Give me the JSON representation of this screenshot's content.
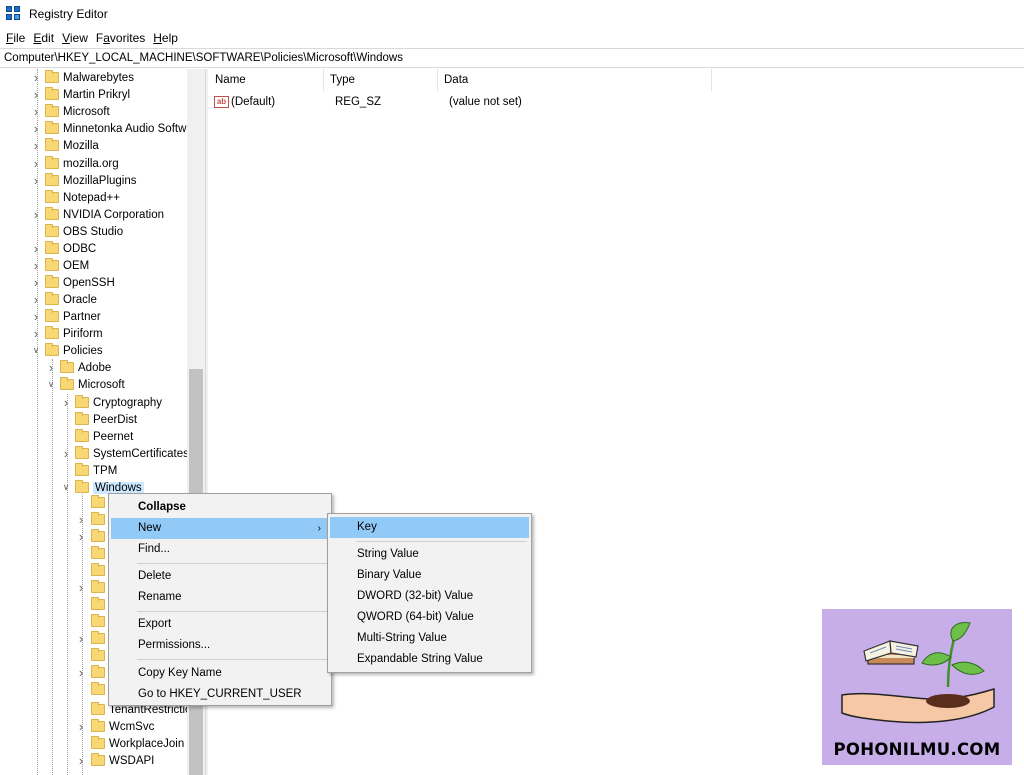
{
  "window": {
    "title": "Registry Editor"
  },
  "menubar": {
    "items": [
      {
        "label": "File",
        "u": "F",
        "rest": "ile"
      },
      {
        "label": "Edit",
        "u": "E",
        "rest": "dit"
      },
      {
        "label": "View",
        "u": "V",
        "rest": "iew"
      },
      {
        "label": "Favorites",
        "u": "a",
        "pre": "F",
        "rest": "vorites"
      },
      {
        "label": "Help",
        "u": "H",
        "rest": "elp"
      }
    ]
  },
  "address": "Computer\\HKEY_LOCAL_MACHINE\\SOFTWARE\\Policies\\Microsoft\\Windows",
  "tree": [
    {
      "label": "Malwarebytes",
      "expanded": false
    },
    {
      "label": "Martin Prikryl",
      "expanded": false
    },
    {
      "label": "Microsoft",
      "expanded": false
    },
    {
      "label": "Minnetonka Audio Softw",
      "expanded": false
    },
    {
      "label": "Mozilla",
      "expanded": false
    },
    {
      "label": "mozilla.org",
      "expanded": false
    },
    {
      "label": "MozillaPlugins",
      "expanded": false
    },
    {
      "label": "Notepad++",
      "expanded": null
    },
    {
      "label": "NVIDIA Corporation",
      "expanded": false
    },
    {
      "label": "OBS Studio",
      "expanded": null
    },
    {
      "label": "ODBC",
      "expanded": false
    },
    {
      "label": "OEM",
      "expanded": false
    },
    {
      "label": "OpenSSH",
      "expanded": false
    },
    {
      "label": "Oracle",
      "expanded": false
    },
    {
      "label": "Partner",
      "expanded": false
    },
    {
      "label": "Piriform",
      "expanded": false
    },
    {
      "label": "Policies",
      "expanded": true
    },
    {
      "label": "Adobe",
      "expanded": false
    },
    {
      "label": "Microsoft",
      "expanded": true
    },
    {
      "label": "Cryptography",
      "expanded": false
    },
    {
      "label": "PeerDist",
      "expanded": null
    },
    {
      "label": "Peernet",
      "expanded": null
    },
    {
      "label": "SystemCertificates",
      "expanded": false
    },
    {
      "label": "TPM",
      "expanded": null
    },
    {
      "label": "Windows",
      "expanded": true,
      "selected": true
    },
    {
      "label": "TenantRestrictio",
      "expanded": null
    },
    {
      "label": "WcmSvc",
      "expanded": false
    },
    {
      "label": "WorkplaceJoin",
      "expanded": null
    },
    {
      "label": "WSDAPI",
      "expanded": false
    }
  ],
  "list": {
    "columns": [
      "Name",
      "Type",
      "Data"
    ],
    "rows": [
      {
        "name": "(Default)",
        "type": "REG_SZ",
        "data": "(value not set)",
        "icon": "string-value-icon"
      }
    ]
  },
  "context_menu": {
    "items": [
      "Collapse",
      "New",
      "Find...",
      "Delete",
      "Rename",
      "Export",
      "Permissions...",
      "Copy Key Name",
      "Go to HKEY_CURRENT_USER"
    ]
  },
  "submenu": {
    "items": [
      "Key",
      "String Value",
      "Binary Value",
      "DWORD (32-bit) Value",
      "QWORD (64-bit) Value",
      "Multi-String Value",
      "Expandable String Value"
    ]
  },
  "watermark": {
    "text": "POHONILMU.COM"
  },
  "colors": {
    "highlight": "#91c9f7",
    "selection": "#cce8ff",
    "folder": "#f8d775",
    "watermark_bg": "#c8aee8"
  }
}
